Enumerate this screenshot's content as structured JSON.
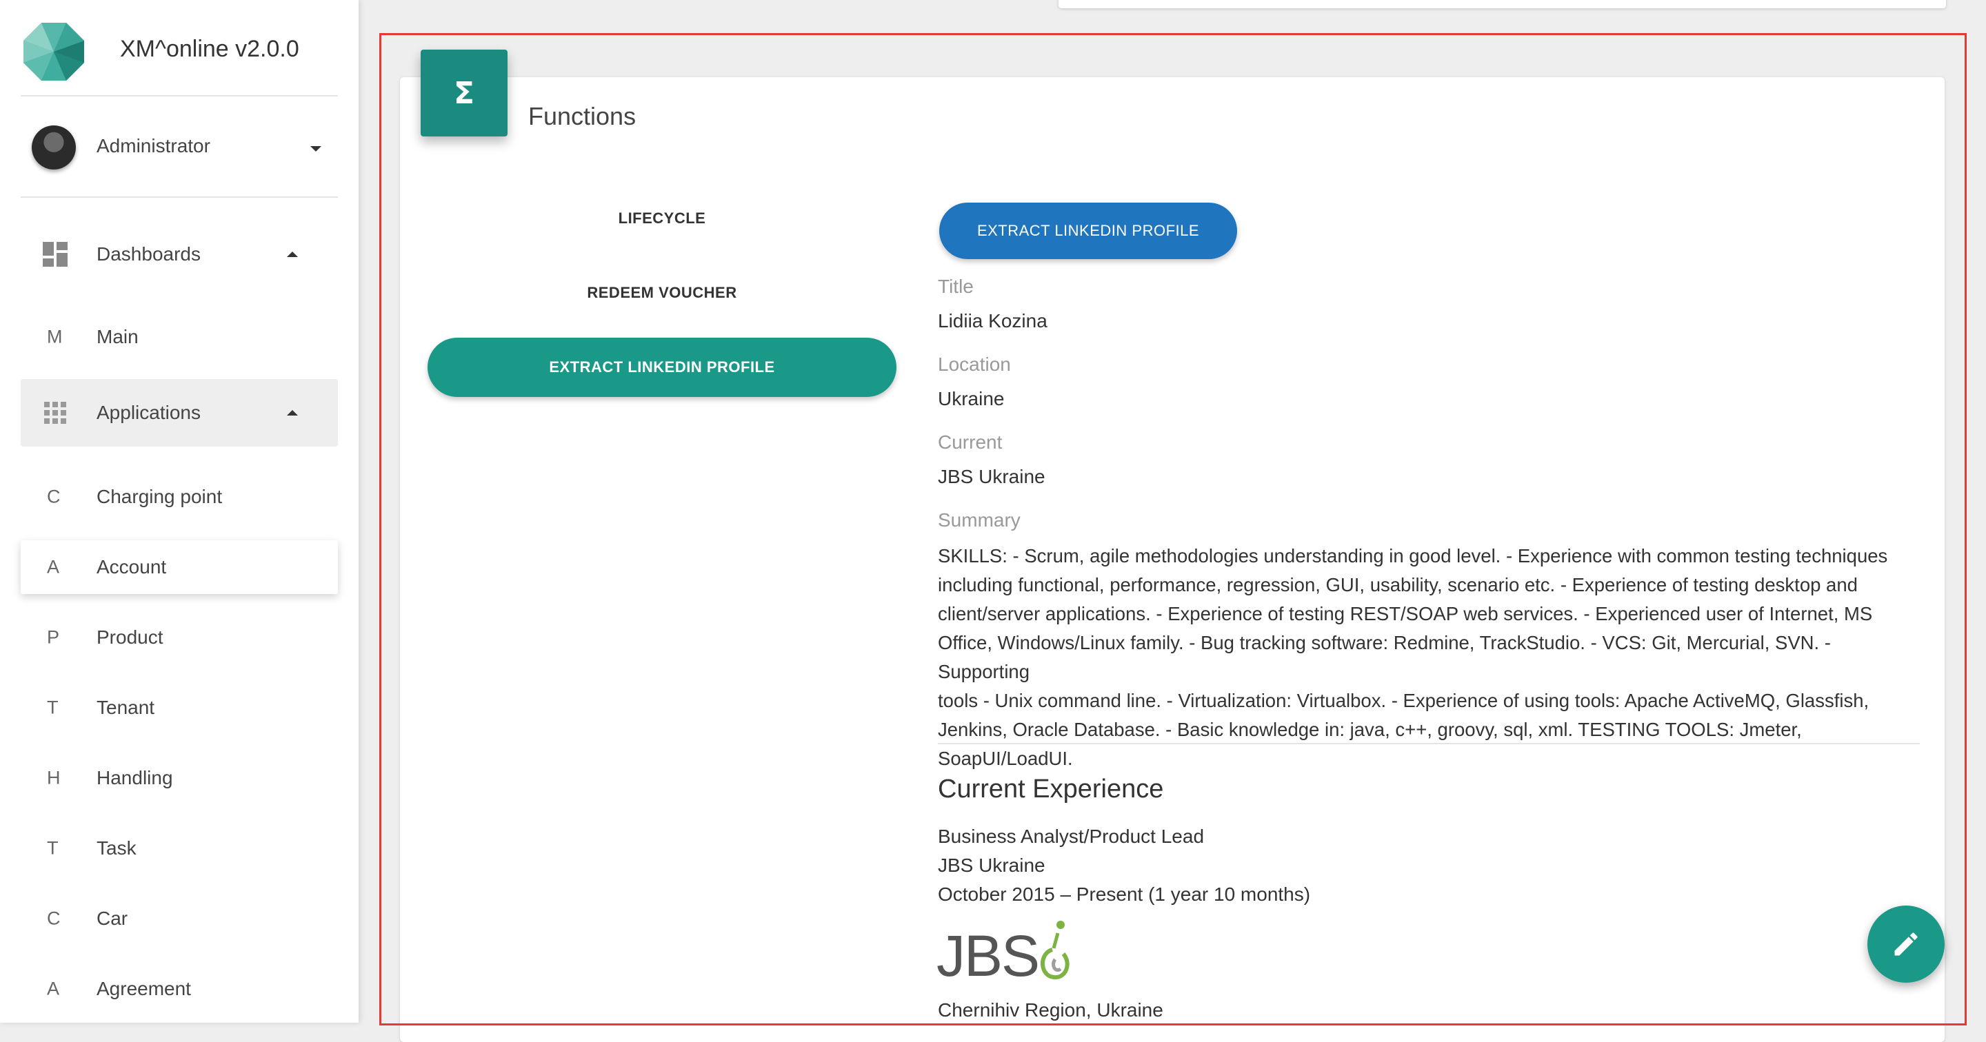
{
  "app": {
    "title": "XM^online v2.0.0"
  },
  "user": {
    "name": "Administrator"
  },
  "sidebar": {
    "dashboards": {
      "label": "Dashboards"
    },
    "main": {
      "letter": "M",
      "label": "Main"
    },
    "applications": {
      "label": "Applications"
    },
    "items": [
      {
        "letter": "C",
        "label": "Charging point"
      },
      {
        "letter": "A",
        "label": "Account"
      },
      {
        "letter": "P",
        "label": "Product"
      },
      {
        "letter": "T",
        "label": "Tenant"
      },
      {
        "letter": "H",
        "label": "Handling"
      },
      {
        "letter": "T",
        "label": "Task"
      },
      {
        "letter": "C",
        "label": "Car"
      },
      {
        "letter": "A",
        "label": "Agreement"
      }
    ]
  },
  "functions": {
    "icon": "Σ",
    "title": "Functions",
    "list": [
      "LIFECYCLE",
      "REDEEM VOUCHER",
      "EXTRACT LINKEDIN PROFILE"
    ],
    "active_index": 2
  },
  "profile": {
    "extract_button": "EXTRACT LINKEDIN PROFILE",
    "fields": [
      {
        "label": "Title",
        "value": "Lidiia Kozina"
      },
      {
        "label": "Location",
        "value": "Ukraine"
      },
      {
        "label": "Current",
        "value": "JBS Ukraine"
      }
    ],
    "summary_label": "Summary",
    "summary_lines": [
      "SKILLS: - Scrum, agile methodologies understanding in good level. - Experience with common testing techniques",
      "including functional, performance, regression, GUI, usability, scenario etc. - Experience of testing desktop and",
      "client/server applications. - Experience of testing REST/SOAP web services. - Experienced user of Internet, MS",
      "Office, Windows/Linux family. - Bug tracking software: Redmine, TrackStudio. - VCS: Git, Mercurial, SVN. - Supporting",
      "tools - Unix command line. - Virtualization: Virtualbox. - Experience of using tools: Apache ActiveMQ, Glassfish,",
      "Jenkins, Oracle Database. - Basic knowledge in: java, c++, groovy, sql, xml. TESTING TOOLS: Jmeter, SoapUI/LoadUI."
    ],
    "experience": {
      "heading": "Current Experience",
      "position": "Business Analyst/Product Lead",
      "company": "JBS Ukraine",
      "period": "October 2015 – Present (1 year 10 months)",
      "logo_text": "JBS",
      "location": "Chernihiv Region, Ukraine"
    }
  },
  "icons": {
    "logo": "xm-logo-icon",
    "dashboards": "dashboard-icon",
    "applications": "apps-grid-icon",
    "fab": "pencil-icon"
  },
  "colors": {
    "teal": "#1a9888",
    "blue_button": "#1f76bf",
    "frame": "#e53935"
  }
}
